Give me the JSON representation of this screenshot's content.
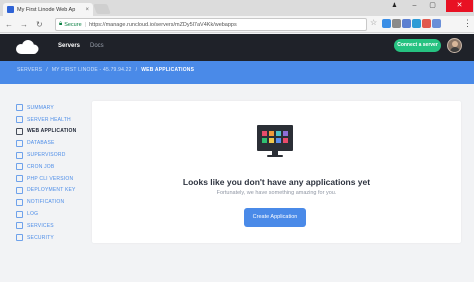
{
  "browser": {
    "tab_title": "My First Linode Web Ap",
    "tab_close": "×",
    "nav": {
      "back": "←",
      "forward": "→",
      "reload": "↻"
    },
    "address": {
      "secure_label": "Secure",
      "separator": "|",
      "url": "https://manage.runcloud.io/servers/mZDy5l7aV4Kk/webapps"
    },
    "window_controls": {
      "user": "♟",
      "minimize": "–",
      "maximize": "▢",
      "close": "✕"
    },
    "menu": "⋮",
    "extension_colors": [
      "#3a8ee6",
      "#8a8a8a",
      "#5b7fd1",
      "#2d9bd6",
      "#e05a4f",
      "#6a8fd8"
    ]
  },
  "app": {
    "nav": {
      "servers": "Servers",
      "docs": "Docs"
    },
    "connect_button": "Connect a server",
    "breadcrumb": {
      "items": [
        "SERVERS",
        "MY FIRST LINODE - 45.79.94.22",
        "WEB APPLICATIONS"
      ],
      "separator": "/"
    },
    "sidebar": [
      {
        "label": "SUMMARY",
        "icon": "summary-icon",
        "active": false
      },
      {
        "label": "SERVER HEALTH",
        "icon": "pulse-icon",
        "active": false
      },
      {
        "label": "WEB APPLICATION",
        "icon": "globe-icon",
        "active": true
      },
      {
        "label": "DATABASE",
        "icon": "database-icon",
        "active": false
      },
      {
        "label": "SUPERVISORD",
        "icon": "supervisor-icon",
        "active": false
      },
      {
        "label": "CRON JOB",
        "icon": "clock-icon",
        "active": false
      },
      {
        "label": "PHP CLI VERSION",
        "icon": "code-icon",
        "active": false
      },
      {
        "label": "DEPLOYMENT KEY",
        "icon": "key-icon",
        "active": false
      },
      {
        "label": "NOTIFICATION",
        "icon": "bell-icon",
        "active": false
      },
      {
        "label": "LOG",
        "icon": "file-icon",
        "active": false
      },
      {
        "label": "SERVICES",
        "icon": "services-icon",
        "active": false
      },
      {
        "label": "SECURITY",
        "icon": "shield-icon",
        "active": false
      }
    ],
    "empty_state": {
      "title": "Looks like you don't have any applications yet",
      "subtitle": "Fortunately, we have something amazing for you.",
      "button": "Create Application",
      "tile_colors": [
        "#e84b6b",
        "#f29a3a",
        "#4fc3c7",
        "#8e6fd8",
        "#2fbf71",
        "#f2c94c",
        "#5b8def",
        "#e84b6b"
      ]
    },
    "colors": {
      "accent": "#4a8ae8",
      "header": "#1f2229",
      "success": "#26c281"
    }
  }
}
